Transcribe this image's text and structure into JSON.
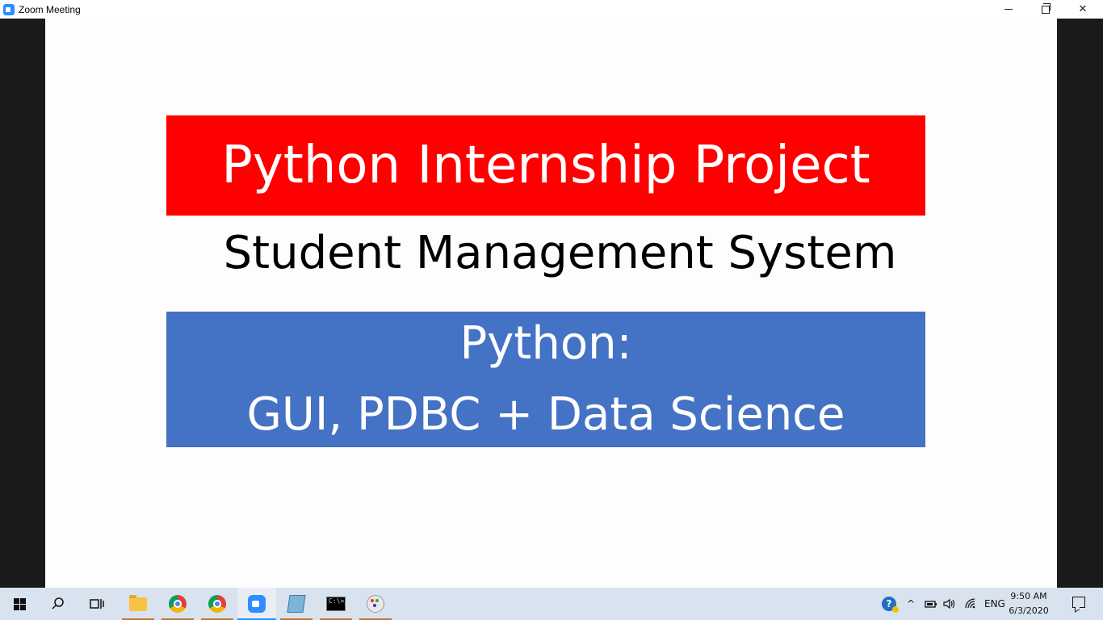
{
  "window": {
    "title": "Zoom Meeting",
    "minimize_icon": "minimize-icon",
    "maximize_icon": "restore-icon",
    "close_glyph": "✕"
  },
  "slide": {
    "title": "Python Internship Project",
    "subtitle": "Student Management System",
    "topic_line1": "Python:",
    "topic_line2": "GUI, PDBC + Data Science",
    "colors": {
      "title_bg": "#fe0000",
      "topic_bg": "#4472c4",
      "text_light": "#ffffff"
    }
  },
  "taskbar": {
    "search_glyph": "⚲",
    "items": [
      {
        "name": "start-button",
        "icon": "windows-logo-icon"
      },
      {
        "name": "search-button",
        "icon": "search-icon"
      },
      {
        "name": "task-view-button",
        "icon": "task-view-icon"
      },
      {
        "name": "file-explorer",
        "icon": "folder-icon"
      },
      {
        "name": "chrome-1",
        "icon": "chrome-icon"
      },
      {
        "name": "chrome-2",
        "icon": "chrome-icon"
      },
      {
        "name": "zoom",
        "icon": "zoom-icon"
      },
      {
        "name": "notepad",
        "icon": "notepad-icon"
      },
      {
        "name": "command-prompt",
        "icon": "cmd-icon"
      },
      {
        "name": "paint",
        "icon": "paint-icon"
      }
    ],
    "cmd_text": "C:\\>_",
    "tray": {
      "help_glyph": "?",
      "chevron_glyph": "^",
      "battery_glyph": "▭",
      "volume_glyph": "🔈",
      "wifi_glyph": "≋",
      "language": "ENG",
      "time": "9:50 AM",
      "date": "6/3/2020"
    }
  }
}
